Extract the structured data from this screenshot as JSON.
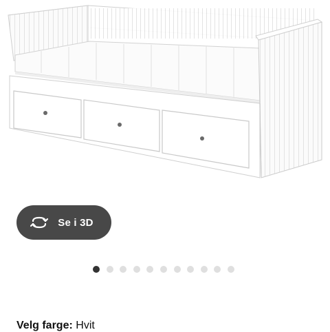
{
  "gallery": {
    "image_alt": "product-image-daybed",
    "view_3d_label": "Se i 3D",
    "view_3d_icon": "rotate-3d-icon",
    "dots_total": 11,
    "active_dot": 0
  },
  "color_selector": {
    "label": "Velg farge:",
    "value": "Hvit"
  },
  "colors": {
    "button_bg": "#484848",
    "dot_active": "#333333",
    "dot_inactive": "#dfdfdf"
  }
}
